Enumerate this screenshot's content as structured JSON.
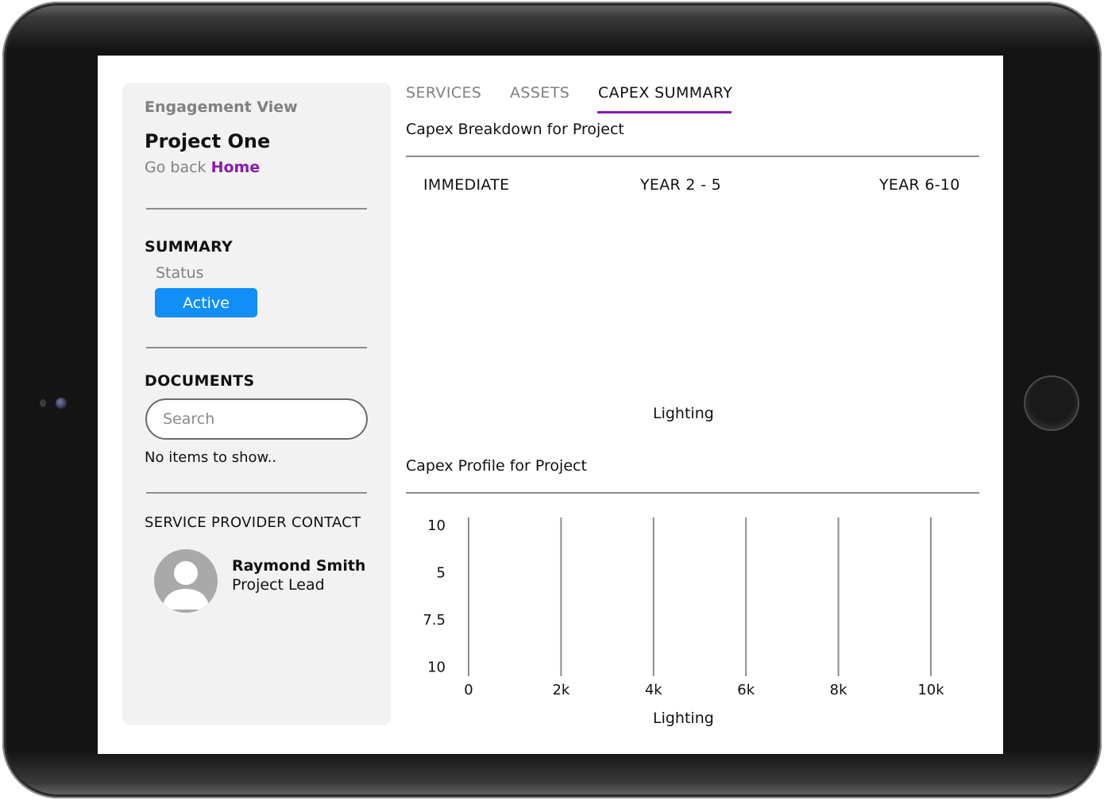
{
  "sidebar": {
    "engagement_label": "Engagement View",
    "project_title": "Project One",
    "go_back_text": "Go back",
    "home_link": "Home",
    "summary_heading": "SUMMARY",
    "status_label": "Status",
    "status_value": "Active",
    "documents_heading": "DOCUMENTS",
    "search_placeholder": "Search",
    "no_items": "No items to show..",
    "contact_heading": "SERVICE PROVIDER CONTACT",
    "contact_name": "Raymond Smith",
    "contact_role": "Project Lead"
  },
  "tabs": {
    "services": "SERVICES",
    "assets": "ASSETS",
    "capex_summary": "CAPEX SUMMARY",
    "active": "capex_summary"
  },
  "breakdown": {
    "title": "Capex Breakdown for Project",
    "periods": [
      "IMMEDIATE",
      "YEAR 2 - 5",
      "YEAR 6-10"
    ],
    "category_label": "Lighting"
  },
  "profile": {
    "title": "Capex Profile for Project"
  },
  "chart_data": {
    "type": "bar",
    "orientation": "horizontal",
    "categories": [
      "10",
      "5",
      "7.5",
      "10"
    ],
    "x_ticks": [
      "0",
      "2k",
      "4k",
      "6k",
      "8k",
      "10k"
    ],
    "xlim": [
      0,
      10000
    ],
    "xlabel": "Lighting",
    "values": [],
    "grid": "vertical"
  },
  "colors": {
    "accent": "#8a1ab0",
    "status_active": "#0f8ff7",
    "sidebar_bg": "#f2f2f2"
  }
}
